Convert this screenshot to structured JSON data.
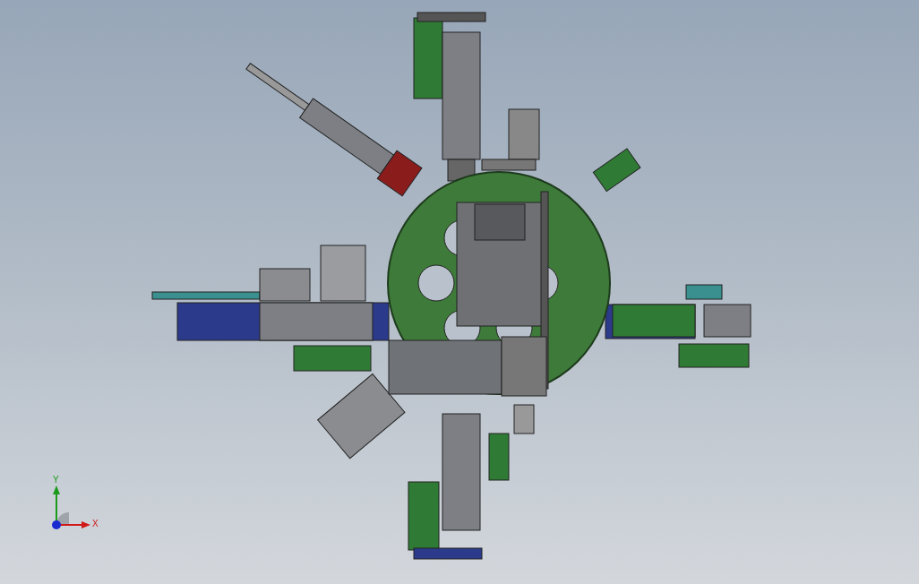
{
  "viewport": {
    "axis_triad": {
      "x_label": "X",
      "y_label": "Y"
    }
  }
}
